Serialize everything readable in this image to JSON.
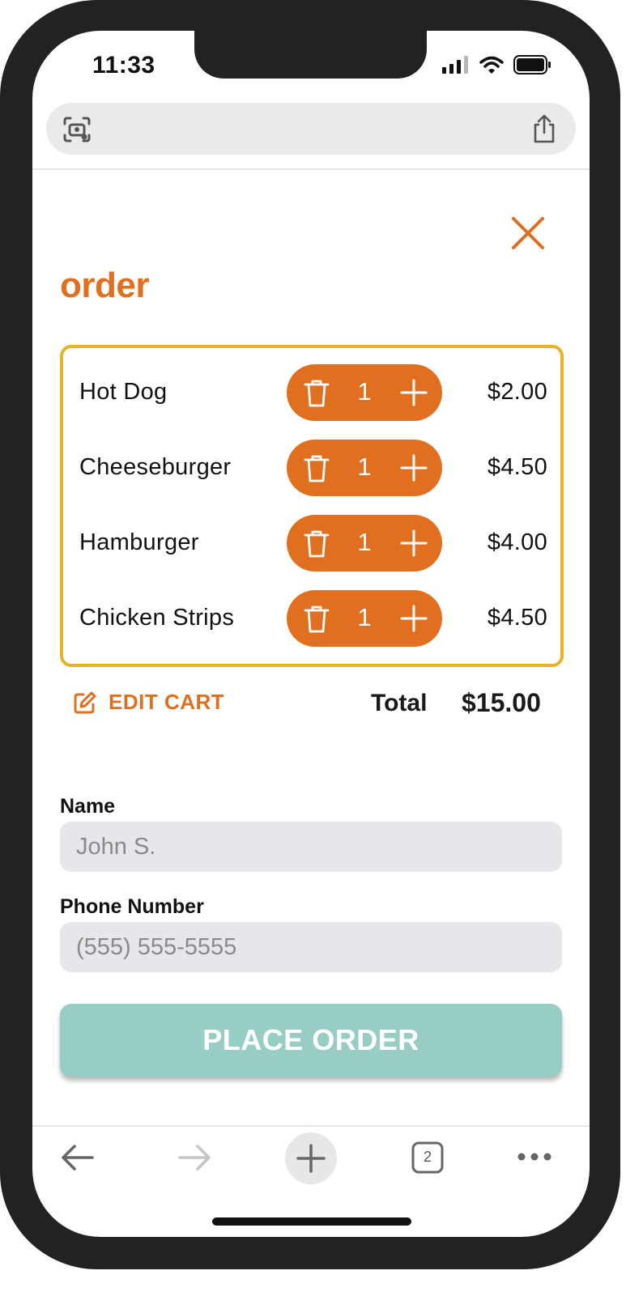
{
  "status_bar": {
    "time": "11:33"
  },
  "browser": {
    "tabs_count": "2"
  },
  "page": {
    "brand": "order",
    "cart_items": [
      {
        "name": "Hot Dog",
        "qty": "1",
        "price": "$2.00"
      },
      {
        "name": "Cheeseburger",
        "qty": "1",
        "price": "$4.50"
      },
      {
        "name": "Hamburger",
        "qty": "1",
        "price": "$4.00"
      },
      {
        "name": "Chicken Strips",
        "qty": "1",
        "price": "$4.50"
      }
    ],
    "edit_cart_label": "EDIT CART",
    "total_label": "Total",
    "total_value": "$15.00",
    "name_label": "Name",
    "name_placeholder": "John S.",
    "phone_label": "Phone Number",
    "phone_placeholder": "(555) 555-5555",
    "place_order_label": "PLACE ORDER"
  },
  "colors": {
    "accent": "#e0701f",
    "cart_border": "#e8b228",
    "button": "#97cdc4",
    "input_bg": "#e6e7ea"
  },
  "icons": {
    "status": [
      "signal-icon",
      "wifi-icon",
      "battery-icon"
    ],
    "browser_bar": [
      "camera-lens-icon",
      "share-icon"
    ],
    "row": [
      "trash-icon",
      "plus-icon"
    ],
    "page": [
      "close-icon",
      "edit-icon"
    ],
    "bottom_nav": [
      "back-arrow-icon",
      "forward-arrow-icon",
      "new-tab-plus-icon",
      "tabs-icon",
      "more-icon"
    ]
  }
}
